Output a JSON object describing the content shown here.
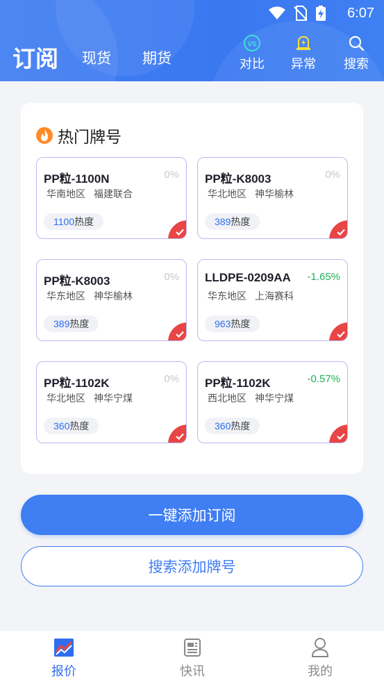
{
  "status_bar": {
    "time": "6:07"
  },
  "header": {
    "title": "订阅",
    "tabs": [
      "现货",
      "期货"
    ],
    "actions": [
      {
        "label": "对比",
        "icon": "vs-icon"
      },
      {
        "label": "异常",
        "icon": "alarm-icon"
      },
      {
        "label": "搜索",
        "icon": "search-icon"
      }
    ]
  },
  "hot": {
    "title": "热门牌号",
    "items": [
      {
        "name": "PP粒-1100N",
        "change": "0%",
        "region": "华南地区",
        "company": "福建联合",
        "heat_value": "1100",
        "heat_unit": "热度"
      },
      {
        "name": "PP粒-K8003",
        "change": "0%",
        "region": "华北地区",
        "company": "神华榆林",
        "heat_value": "389",
        "heat_unit": "热度"
      },
      {
        "name": "PP粒-K8003",
        "change": "0%",
        "region": "华东地区",
        "company": "神华榆林",
        "heat_value": "389",
        "heat_unit": "热度"
      },
      {
        "name": "LLDPE-0209AA",
        "change": "-1.65%",
        "region": "华东地区",
        "company": "上海赛科",
        "heat_value": "963",
        "heat_unit": "热度"
      },
      {
        "name": "PP粒-1102K",
        "change": "0%",
        "region": "华北地区",
        "company": "神华宁煤",
        "heat_value": "360",
        "heat_unit": "热度"
      },
      {
        "name": "PP粒-1102K",
        "change": "-0.57%",
        "region": "西北地区",
        "company": "神华宁煤",
        "heat_value": "360",
        "heat_unit": "热度"
      }
    ]
  },
  "buttons": {
    "one_click": "一键添加订阅",
    "search_add": "搜索添加牌号"
  },
  "bottom_nav": {
    "items": [
      {
        "label": "报价",
        "active": true
      },
      {
        "label": "快讯",
        "active": false
      },
      {
        "label": "我的",
        "active": false
      }
    ]
  },
  "colors": {
    "primary": "#3f7ef3",
    "negative": "#1fb25a",
    "check": "#e84545",
    "card_border": "#b9b8f2"
  }
}
